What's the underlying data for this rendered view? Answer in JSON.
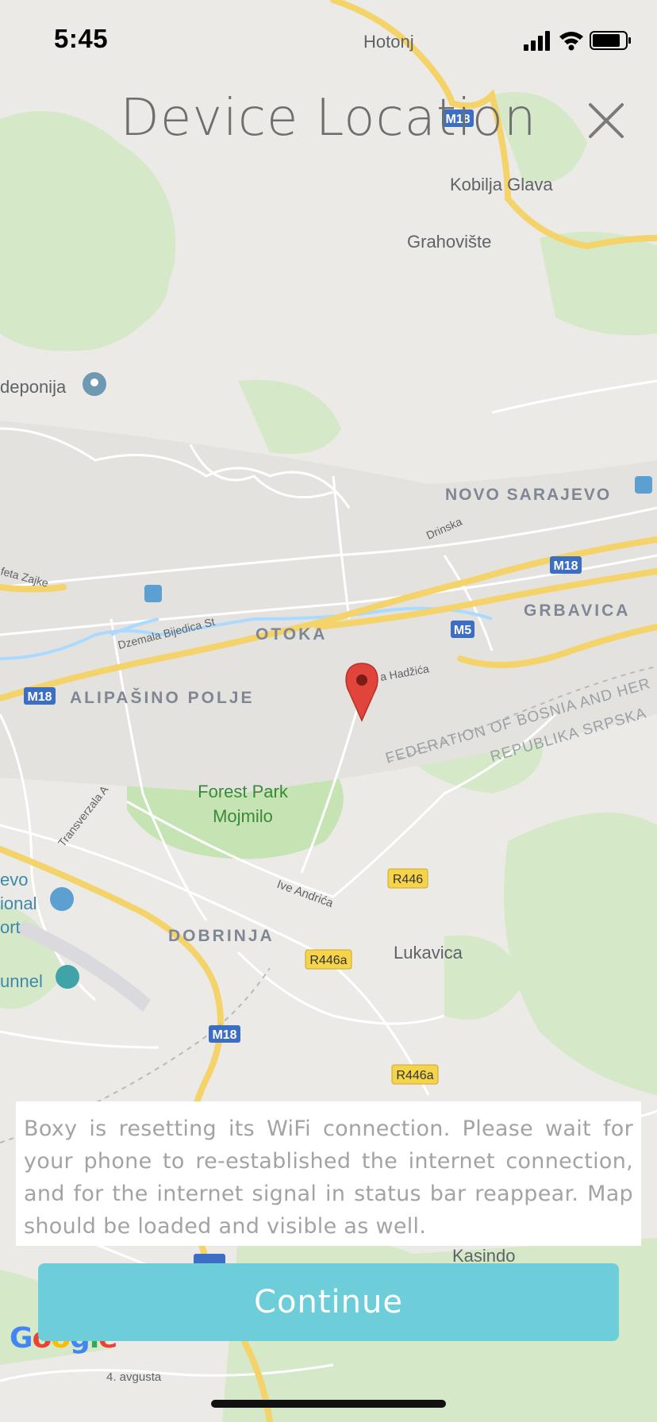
{
  "status_bar": {
    "time": "5:45"
  },
  "header": {
    "title": "Device Location",
    "close_icon": "close-icon"
  },
  "map": {
    "labels": {
      "hotonj": "Hotonj",
      "kobilja_glava": "Kobilja Glava",
      "grahoviste": "Grahovište",
      "deponija": "deponija",
      "novo_sarajevo": "NOVO SARAJEVO",
      "drinska": "Drinska",
      "fetazajke": "feta Zajke",
      "grbavica": "GRBAVICA",
      "dzemala": "Dzemala Bijedica St",
      "otoka": "OTOKA",
      "hadzica": "a Hadžića",
      "alipasino": "ALIPAŠINO POLJE",
      "federation": "FEDERATION OF BOSNIA AND HER",
      "republika": "REPUBLIKA SRPSKA",
      "forest_park_1": "Forest Park",
      "forest_park_2": "Mojmilo",
      "transverzala": "Transverzala A",
      "evo": "evo",
      "ional": "ional",
      "ort": "ort",
      "ive_andrica": "Ive Andrića",
      "dobrinja": "DOBRINJA",
      "lukavica": "Lukavica",
      "unnel": "unnel",
      "kasindo": "Kasindo",
      "avgusta": "4. avgusta",
      "m18": "M18",
      "m5": "M5",
      "r446": "R446",
      "r446a": "R446a"
    },
    "pin_icon": "location-pin-icon",
    "colors": {
      "road": "#f6d66b",
      "park": "#c8e6b9",
      "water": "#aadaff",
      "land": "#eceae6"
    }
  },
  "message": "Boxy is resetting its WiFi connection. Please wait for your phone to re-established the internet connection, and for the internet signal in status bar reappear. Map should be loaded and visible as well.",
  "continue_button": {
    "label": "Continue",
    "color": "#6dcdd9"
  },
  "google_logo": "Google"
}
